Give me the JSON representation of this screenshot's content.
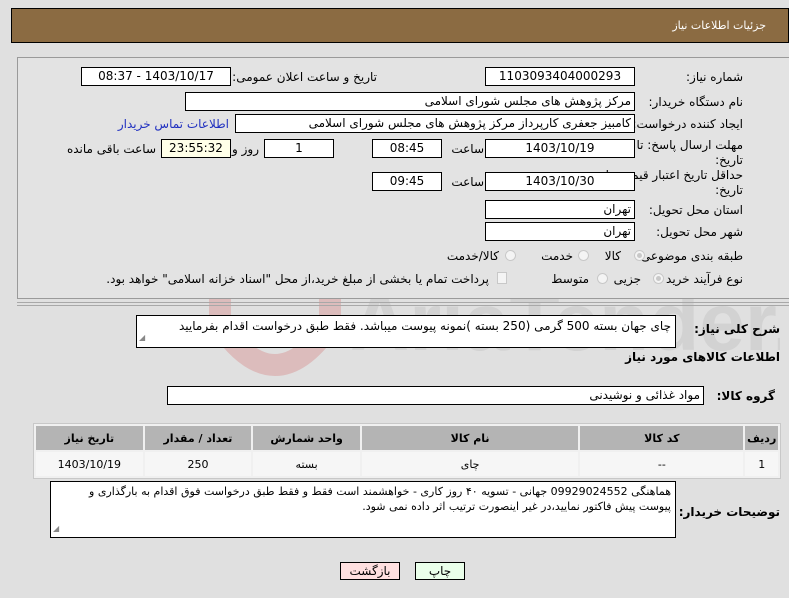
{
  "header": {
    "title": "جزئیات اطلاعات نیاز"
  },
  "form": {
    "need_number": {
      "label": "شماره نیاز:",
      "value": "1103093404000293"
    },
    "announce": {
      "label": "تاریخ و ساعت اعلان عمومی:",
      "value": "1403/10/17 - 08:37"
    },
    "buyer_org": {
      "label": "نام دستگاه خریدار:",
      "value": "مرکز پژوهش های مجلس شورای اسلامی"
    },
    "creator": {
      "label": "ایجاد کننده درخواست:",
      "value": "کامبیز جعفری کارپرداز مرکز پژوهش های مجلس شورای اسلامی",
      "contact_link": "اطلاعات تماس خریدار"
    },
    "reply_deadline": {
      "label": "مهلت ارسال پاسخ: تا تاریخ:",
      "date": "1403/10/19",
      "time_label": "ساعت",
      "time": "08:45",
      "days": "1",
      "days_label": "روز و",
      "remaining": "23:55:32",
      "remaining_label": "ساعت باقی مانده"
    },
    "price_validity": {
      "label": "حداقل تاریخ اعتبار قیمت: تا تاریخ:",
      "date": "1403/10/30",
      "time_label": "ساعت",
      "time": "09:45"
    },
    "province": {
      "label": "استان محل تحویل:",
      "value": "تهران"
    },
    "city": {
      "label": "شهر محل تحویل:",
      "value": "تهران"
    },
    "category": {
      "label": "طبقه بندی موضوعی:",
      "options": [
        "کالا",
        "خدمت",
        "کالا/خدمت"
      ],
      "selected": "کالا"
    },
    "process": {
      "label": "نوع فرآیند خرید :",
      "options": [
        "جزیی",
        "متوسط"
      ],
      "selected": "جزیی",
      "treasury_note": "پرداخت تمام یا بخشی از مبلغ خرید،از محل \"اسناد خزانه اسلامی\" خواهد بود."
    }
  },
  "summary": {
    "label": "شرح کلی نیاز:",
    "value": "چای جهان بسته 500 گرمی (250 بسته )نمونه پیوست میباشد. فقط طبق درخواست اقدام بفرمایید"
  },
  "goods_section": {
    "title": "اطلاعات کالاهای مورد نیاز",
    "group_label": "گروه کالا:",
    "group_value": "مواد غذائی و نوشیدنی"
  },
  "table": {
    "headers": [
      "ردیف",
      "کد کالا",
      "نام کالا",
      "واحد شمارش",
      "تعداد / مقدار",
      "تاریخ نیاز"
    ],
    "rows": [
      [
        "1",
        "--",
        "چای",
        "بسته",
        "250",
        "1403/10/19"
      ]
    ]
  },
  "buyer_notes": {
    "label": "توضیحات خریدار:",
    "value": "هماهنگی 09929024552  جهانی  - تسویه ۴۰ روز کاری - خواهشمند است فقط و فقط طبق درخواست فوق اقدام به بارگذاری و پیوست پیش فاکتور نمایید،در غیر اینصورت ترتیب اثر داده نمی شود."
  },
  "buttons": {
    "print": "چاپ",
    "back": "بازگشت"
  },
  "watermark": {
    "text": "AriaTender.neT"
  }
}
